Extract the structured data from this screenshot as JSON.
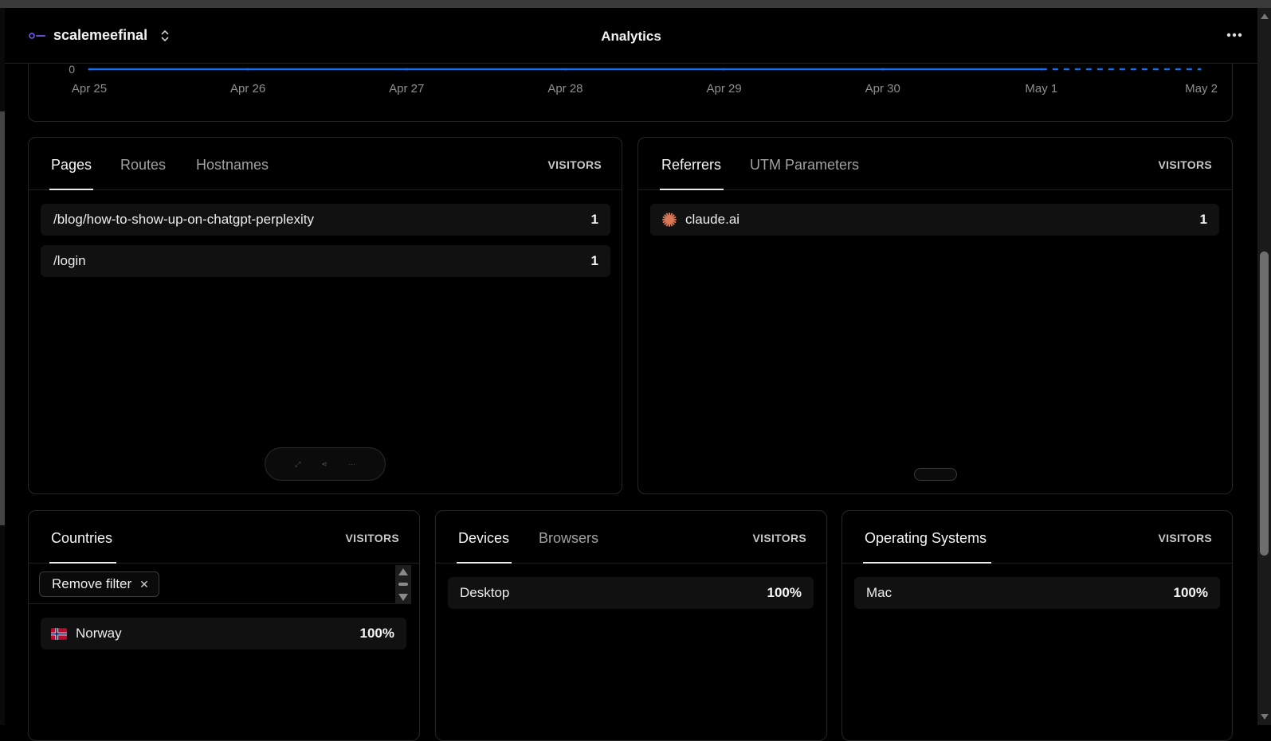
{
  "header": {
    "project_name": "scalemeefinal",
    "title": "Analytics"
  },
  "chart_data": {
    "type": "line",
    "x": [
      "Apr 25",
      "Apr 26",
      "Apr 27",
      "Apr 28",
      "Apr 29",
      "Apr 30",
      "May 1",
      "May 2"
    ],
    "y_tick_visible": "0",
    "series": [
      {
        "values": [
          0,
          0,
          0,
          0,
          0,
          0,
          0,
          0
        ]
      }
    ],
    "line_color": "#1a6df0",
    "dashed_from": "May 1"
  },
  "pages_card": {
    "tabs": [
      "Pages",
      "Routes",
      "Hostnames"
    ],
    "active_tab": 0,
    "column_label": "VISITORS",
    "rows": [
      {
        "label": "/blog/how-to-show-up-on-chatgpt-perplexity",
        "value": "1"
      },
      {
        "label": "/login",
        "value": "1"
      }
    ],
    "pager_icons": [
      "expand-icon",
      "share-icon",
      "more-icon"
    ]
  },
  "referrers_card": {
    "tabs": [
      "Referrers",
      "UTM Parameters"
    ],
    "active_tab": 0,
    "column_label": "VISITORS",
    "rows": [
      {
        "label": "claude.ai",
        "value": "1",
        "icon": "claude-logo-icon",
        "icon_color": "#d97757"
      }
    ]
  },
  "countries_card": {
    "tabs": [
      "Countries"
    ],
    "active_tab": 0,
    "column_label": "VISITORS",
    "filter_chip": "Remove filter",
    "rows": [
      {
        "label": "Norway",
        "value": "100%",
        "icon": "norway-flag-icon"
      }
    ]
  },
  "devices_card": {
    "tabs": [
      "Devices",
      "Browsers"
    ],
    "active_tab": 0,
    "column_label": "VISITORS",
    "rows": [
      {
        "label": "Desktop",
        "value": "100%"
      }
    ]
  },
  "os_card": {
    "tabs": [
      "Operating Systems"
    ],
    "active_tab": 0,
    "column_label": "VISITORS",
    "rows": [
      {
        "label": "Mac",
        "value": "100%"
      }
    ]
  },
  "colors": {
    "background": "#000000",
    "card_border": "#262626",
    "row_bg": "#111111",
    "accent_line": "#1a6df0"
  }
}
